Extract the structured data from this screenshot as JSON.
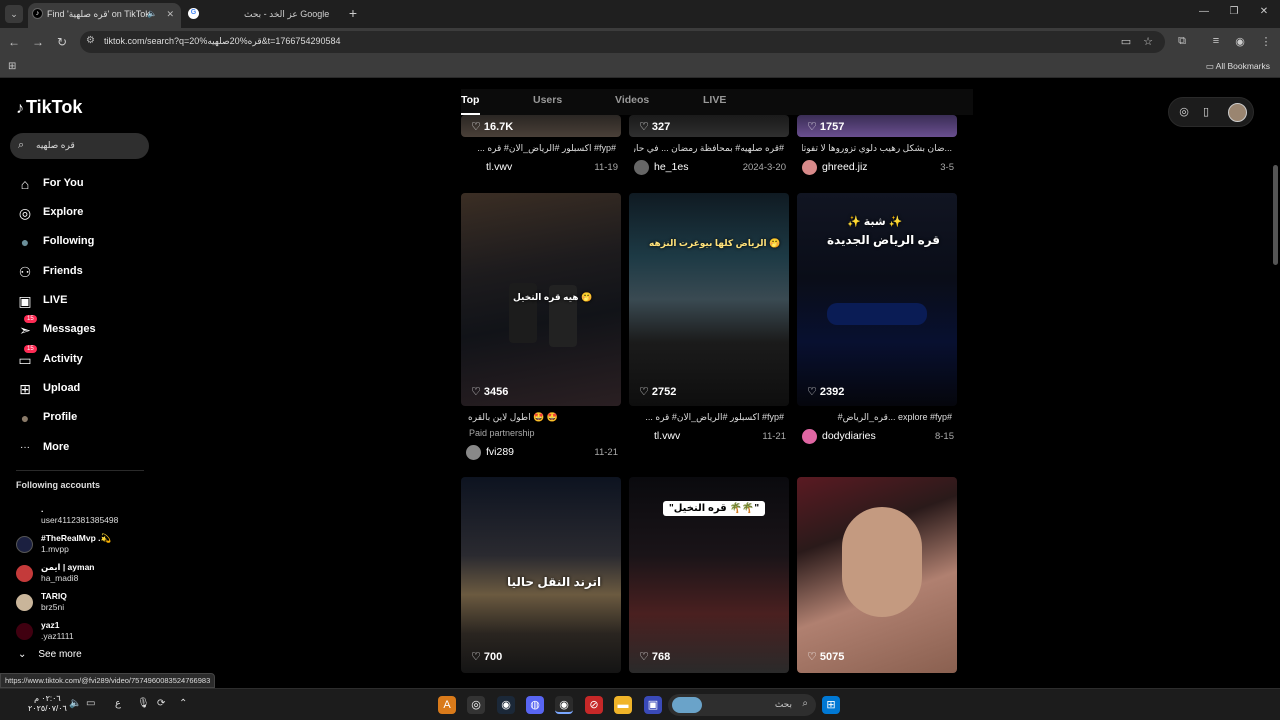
{
  "browser": {
    "tabs": [
      {
        "title": "Find 'قره صلهية' on TikTok",
        "fav": "♪",
        "active": true
      },
      {
        "title": "عز الخد - بحث Google",
        "fav": "G",
        "active": false
      }
    ],
    "url": "tiktok.com/search?q=قره%20صلهيه%20&t=1766754290584",
    "all_bookmarks": "All Bookmarks"
  },
  "sidebar": {
    "logo": "TikTok",
    "search_value": "قره صلهيه",
    "nav": [
      {
        "label": "For You",
        "icon": "home-icon",
        "glyph": "⌂"
      },
      {
        "label": "Explore",
        "icon": "compass-icon",
        "glyph": "◎"
      },
      {
        "label": "Following",
        "icon": "following-avatar-icon",
        "glyph": "●"
      },
      {
        "label": "Friends",
        "icon": "friends-icon",
        "glyph": "⚇"
      },
      {
        "label": "LIVE",
        "icon": "live-icon",
        "glyph": "▣"
      },
      {
        "label": "Messages",
        "icon": "messages-icon",
        "glyph": "➣",
        "badge": "15"
      },
      {
        "label": "Activity",
        "icon": "activity-icon",
        "glyph": "▭",
        "badge": "15"
      },
      {
        "label": "Upload",
        "icon": "upload-icon",
        "glyph": "⊞"
      },
      {
        "label": "Profile",
        "icon": "profile-avatar-icon",
        "glyph": "●"
      },
      {
        "label": "More",
        "icon": "more-icon",
        "glyph": "···"
      }
    ],
    "following_header": "Following accounts",
    "accounts": [
      {
        "name": ".",
        "handle": "user4112381385498",
        "color": "#000000"
      },
      {
        "name": "#TheRealMvp .💫",
        "handle": "1.mvpp",
        "color": "#1b2040"
      },
      {
        "name": "ايمن | ayman",
        "handle": "ha_madi8",
        "color": "#c43a3a"
      },
      {
        "name": "TARIQ",
        "handle": "brz5ni",
        "color": "#c9b59a"
      },
      {
        "name": "yaz1",
        "handle": ".yaz1111",
        "color": "#400010"
      }
    ],
    "see_more": "See more"
  },
  "search_tabs": [
    "Top",
    "Users",
    "Videos",
    "LIVE"
  ],
  "videos": [
    {
      "likes": "16.7K",
      "caption": "#fyp# اكسبلور #الرياض_الان# قره ...",
      "author": "tl.vwv",
      "date": "11-19"
    },
    {
      "likes": "327",
      "caption": "#قره صلهيه# بمحافظة رمضان ... في حارة",
      "author": "he_1es",
      "date": "2024-3-20"
    },
    {
      "likes": "1757",
      "caption": "...ضان بشكل رهيب دلوي تزوروها لا تفوتك",
      "author": "ghreed.jiz",
      "date": "3-5"
    },
    {
      "likes": "3456",
      "caption": "🤩 🤩 اطول لاين بالقره",
      "paid": "Paid partnership",
      "author": "fvi289",
      "date": "11-21",
      "overlay": "هيه قره النخيل 🤭"
    },
    {
      "likes": "2752",
      "caption": "#fyp# اكسبلور #الرياض_الان# قره ...",
      "author": "tl.vwv",
      "date": "11-21",
      "overlay": "الرياض كلها بيوغرت النزهه 🤭"
    },
    {
      "likes": "2392",
      "caption": "#explore #fyp ...قره_الرياض#",
      "author": "dodydiaries",
      "date": "8-15",
      "overlay": "✨ شبة ✨",
      "overlay2": "قره الرياض الجديدة"
    },
    {
      "likes": "700",
      "overlay": "اترند النقل حاليا"
    },
    {
      "likes": "768",
      "overlay": "\"قره النخيل 🌴🌴\""
    },
    {
      "likes": "5075"
    }
  ],
  "status_url": "https://www.tiktok.com/@fvi289/video/7574960083524766983",
  "taskbar": {
    "search_text": "بحث",
    "time": "٠٢:٠٦ م",
    "date": "٢٠٢٥/٠٧/٠٦",
    "lang": "ع"
  }
}
